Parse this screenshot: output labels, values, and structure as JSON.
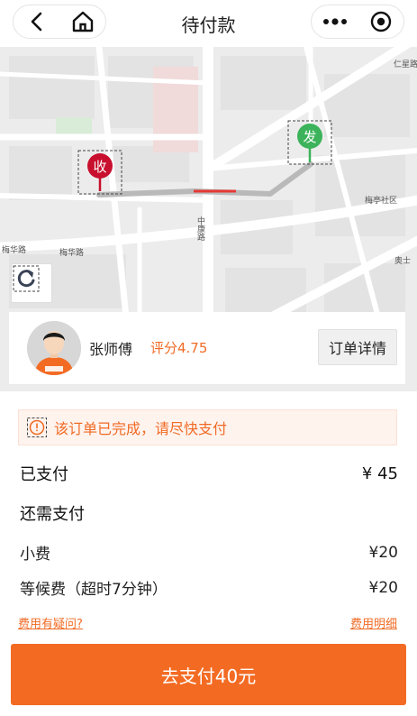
{
  "header": {
    "title": "待付款",
    "back_icon": "chevron-left-icon",
    "home_icon": "home-icon",
    "more_icon": "more-dots-icon",
    "close_icon": "target-close-icon"
  },
  "map": {
    "road_labels": [
      "仁星路",
      "梅亭社区",
      "梅华路",
      "梅华路",
      "中康路",
      "奥士"
    ],
    "start_marker": "发",
    "end_marker": "收",
    "start_color": "#3cb35a",
    "end_color": "#c8102e",
    "route_color": "#b9b9b9",
    "route_highlight_color": "#e53935",
    "refresh_icon": "refresh-icon"
  },
  "driver": {
    "name": "张师傅",
    "rating": "评分4.75",
    "detail_button": "订单详情",
    "avatar_icon": "driver-avatar-icon"
  },
  "notice": {
    "icon": "exclamation-icon",
    "text": "该订单已完成，请尽快支付"
  },
  "fees": {
    "paid_label": "已支付",
    "paid_value": "¥ 45",
    "due_label": "还需支付",
    "tip_label": "小费",
    "tip_value": "¥20",
    "wait_label": "等候费（超时7分钟）",
    "wait_value": "¥20"
  },
  "links": {
    "question": "费用有疑问?",
    "detail": "费用明细"
  },
  "footer": {
    "pay_button": "去支付40元"
  },
  "colors": {
    "accent": "#f36b23",
    "notice_bg": "#fff3ee"
  }
}
